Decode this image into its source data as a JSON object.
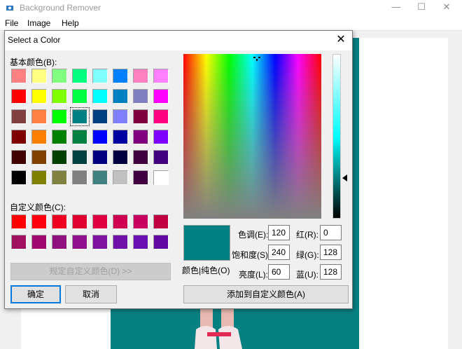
{
  "app": {
    "title": "Background Remover",
    "menu": [
      "File",
      "Image",
      "Help"
    ],
    "window_controls": {
      "minimize": "—",
      "maximize": "☐",
      "close": "✕"
    }
  },
  "dialog": {
    "title": "Select a Color",
    "close_label": "✕",
    "basic_colors_label": "基本颜色(B):",
    "custom_colors_label": "自定义颜色(C):",
    "define_custom_label": "规定自定义颜色(D) >>",
    "ok_label": "确定",
    "cancel_label": "取消",
    "color_solid_label": "颜色|纯色(O)",
    "add_custom_label": "添加到自定义颜色(A)",
    "hue_label": "色调(E):",
    "sat_label": "饱和度(S):",
    "lum_label": "亮度(L):",
    "red_label": "红(R):",
    "green_label": "绿(G):",
    "blue_label": "蓝(U):",
    "hue": "120",
    "sat": "240",
    "lum": "60",
    "red": "0",
    "green": "128",
    "blue": "128",
    "current_color": "#008080",
    "selected_basic_index": 19,
    "basic_colors": [
      "#ff8080",
      "#ffff80",
      "#80ff80",
      "#00ff80",
      "#80ffff",
      "#0080ff",
      "#ff80c0",
      "#ff80ff",
      "#ff0000",
      "#ffff00",
      "#80ff00",
      "#00ff40",
      "#00ffff",
      "#0080c0",
      "#8080c0",
      "#ff00ff",
      "#804040",
      "#ff8040",
      "#00ff00",
      "#008080",
      "#004080",
      "#8080ff",
      "#800040",
      "#ff0080",
      "#800000",
      "#ff8000",
      "#008000",
      "#008040",
      "#0000ff",
      "#0000a0",
      "#800080",
      "#8000ff",
      "#400000",
      "#804000",
      "#004000",
      "#004040",
      "#000080",
      "#000040",
      "#400040",
      "#400080",
      "#000000",
      "#808000",
      "#808040",
      "#808080",
      "#408080",
      "#c0c0c0",
      "#400040",
      "#ffffff"
    ],
    "custom_colors": [
      "#ff0000",
      "#ff0010",
      "#f00020",
      "#e00030",
      "#e00040",
      "#d00050",
      "#c80060",
      "#c00040",
      "#a01060",
      "#a00870",
      "#901080",
      "#901090",
      "#8010a0",
      "#7010a8",
      "#6810b0",
      "#6008a0"
    ]
  }
}
